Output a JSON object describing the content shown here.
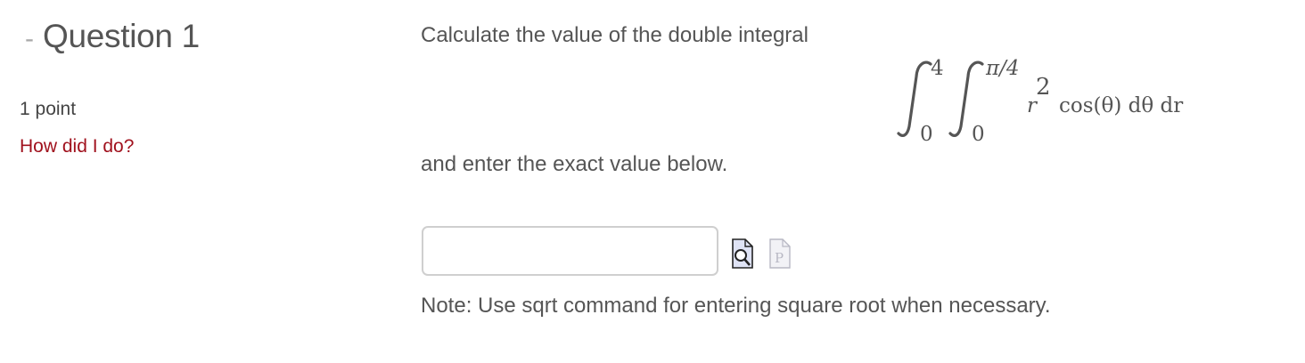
{
  "question": {
    "collapse_symbol": "-",
    "title": "Question 1",
    "points": "1 point",
    "feedback_link": "How did I do?"
  },
  "problem": {
    "prompt": "Calculate the value of the double integral",
    "integral": {
      "outer_upper": "4",
      "outer_lower": "0",
      "inner_upper": "π/4",
      "inner_lower": "0",
      "integrand_base": "r",
      "integrand_exp": "2",
      "integrand_rest": "cos(θ) dθ dr"
    },
    "instruction": "and enter the exact value below."
  },
  "answer": {
    "value": "",
    "placeholder": ""
  },
  "icons": {
    "preview": "preview-magnifier-icon",
    "p": "p-document-icon"
  },
  "note": "Note: Use sqrt command for entering square root when necessary.",
  "colors": {
    "link": "#a0111d",
    "text": "#555555",
    "border": "#cfcfcf"
  }
}
